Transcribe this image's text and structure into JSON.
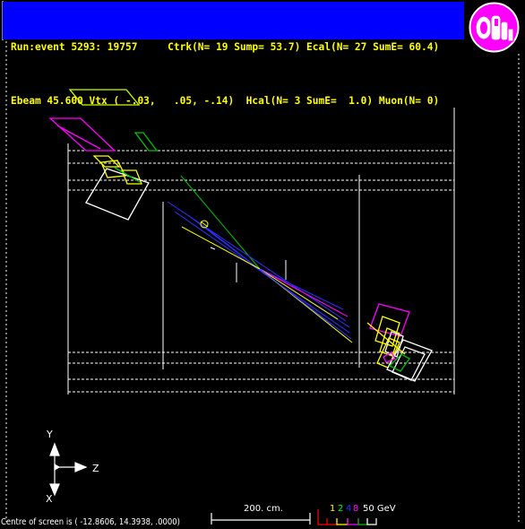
{
  "header": {
    "line1": "Run:event 5293: 19757     Ctrk(N= 19 Sump= 53.7) Ecal(N= 27 SumE= 60.4)",
    "line2": "Ebeam 45.600 Vtx ( -.03,   .05, -.14)  Hcal(N= 3 SumE=  1.0) Muon(N= 0)"
  },
  "logo": {
    "text": "OPAL",
    "color": "#ff00ff"
  },
  "axes": {
    "y_label": "Y",
    "z_label": "Z",
    "x_label": "X"
  },
  "scale": {
    "label": "200. cm."
  },
  "energy_scale": {
    "values": [
      "1",
      "2",
      "4",
      "8"
    ],
    "unit_label": "50 GeV"
  },
  "footer": {
    "text": "Centre of screen is ( -12.8606,  14.3938,   .0000)"
  },
  "colors": {
    "background": "#000000",
    "header_bg": "#0000ff",
    "header_text": "#ffff00",
    "magenta": "#ff00ff",
    "yellow": "#ffff00",
    "green": "#00c000",
    "blue": "#3030ff",
    "white": "#ffffff"
  }
}
